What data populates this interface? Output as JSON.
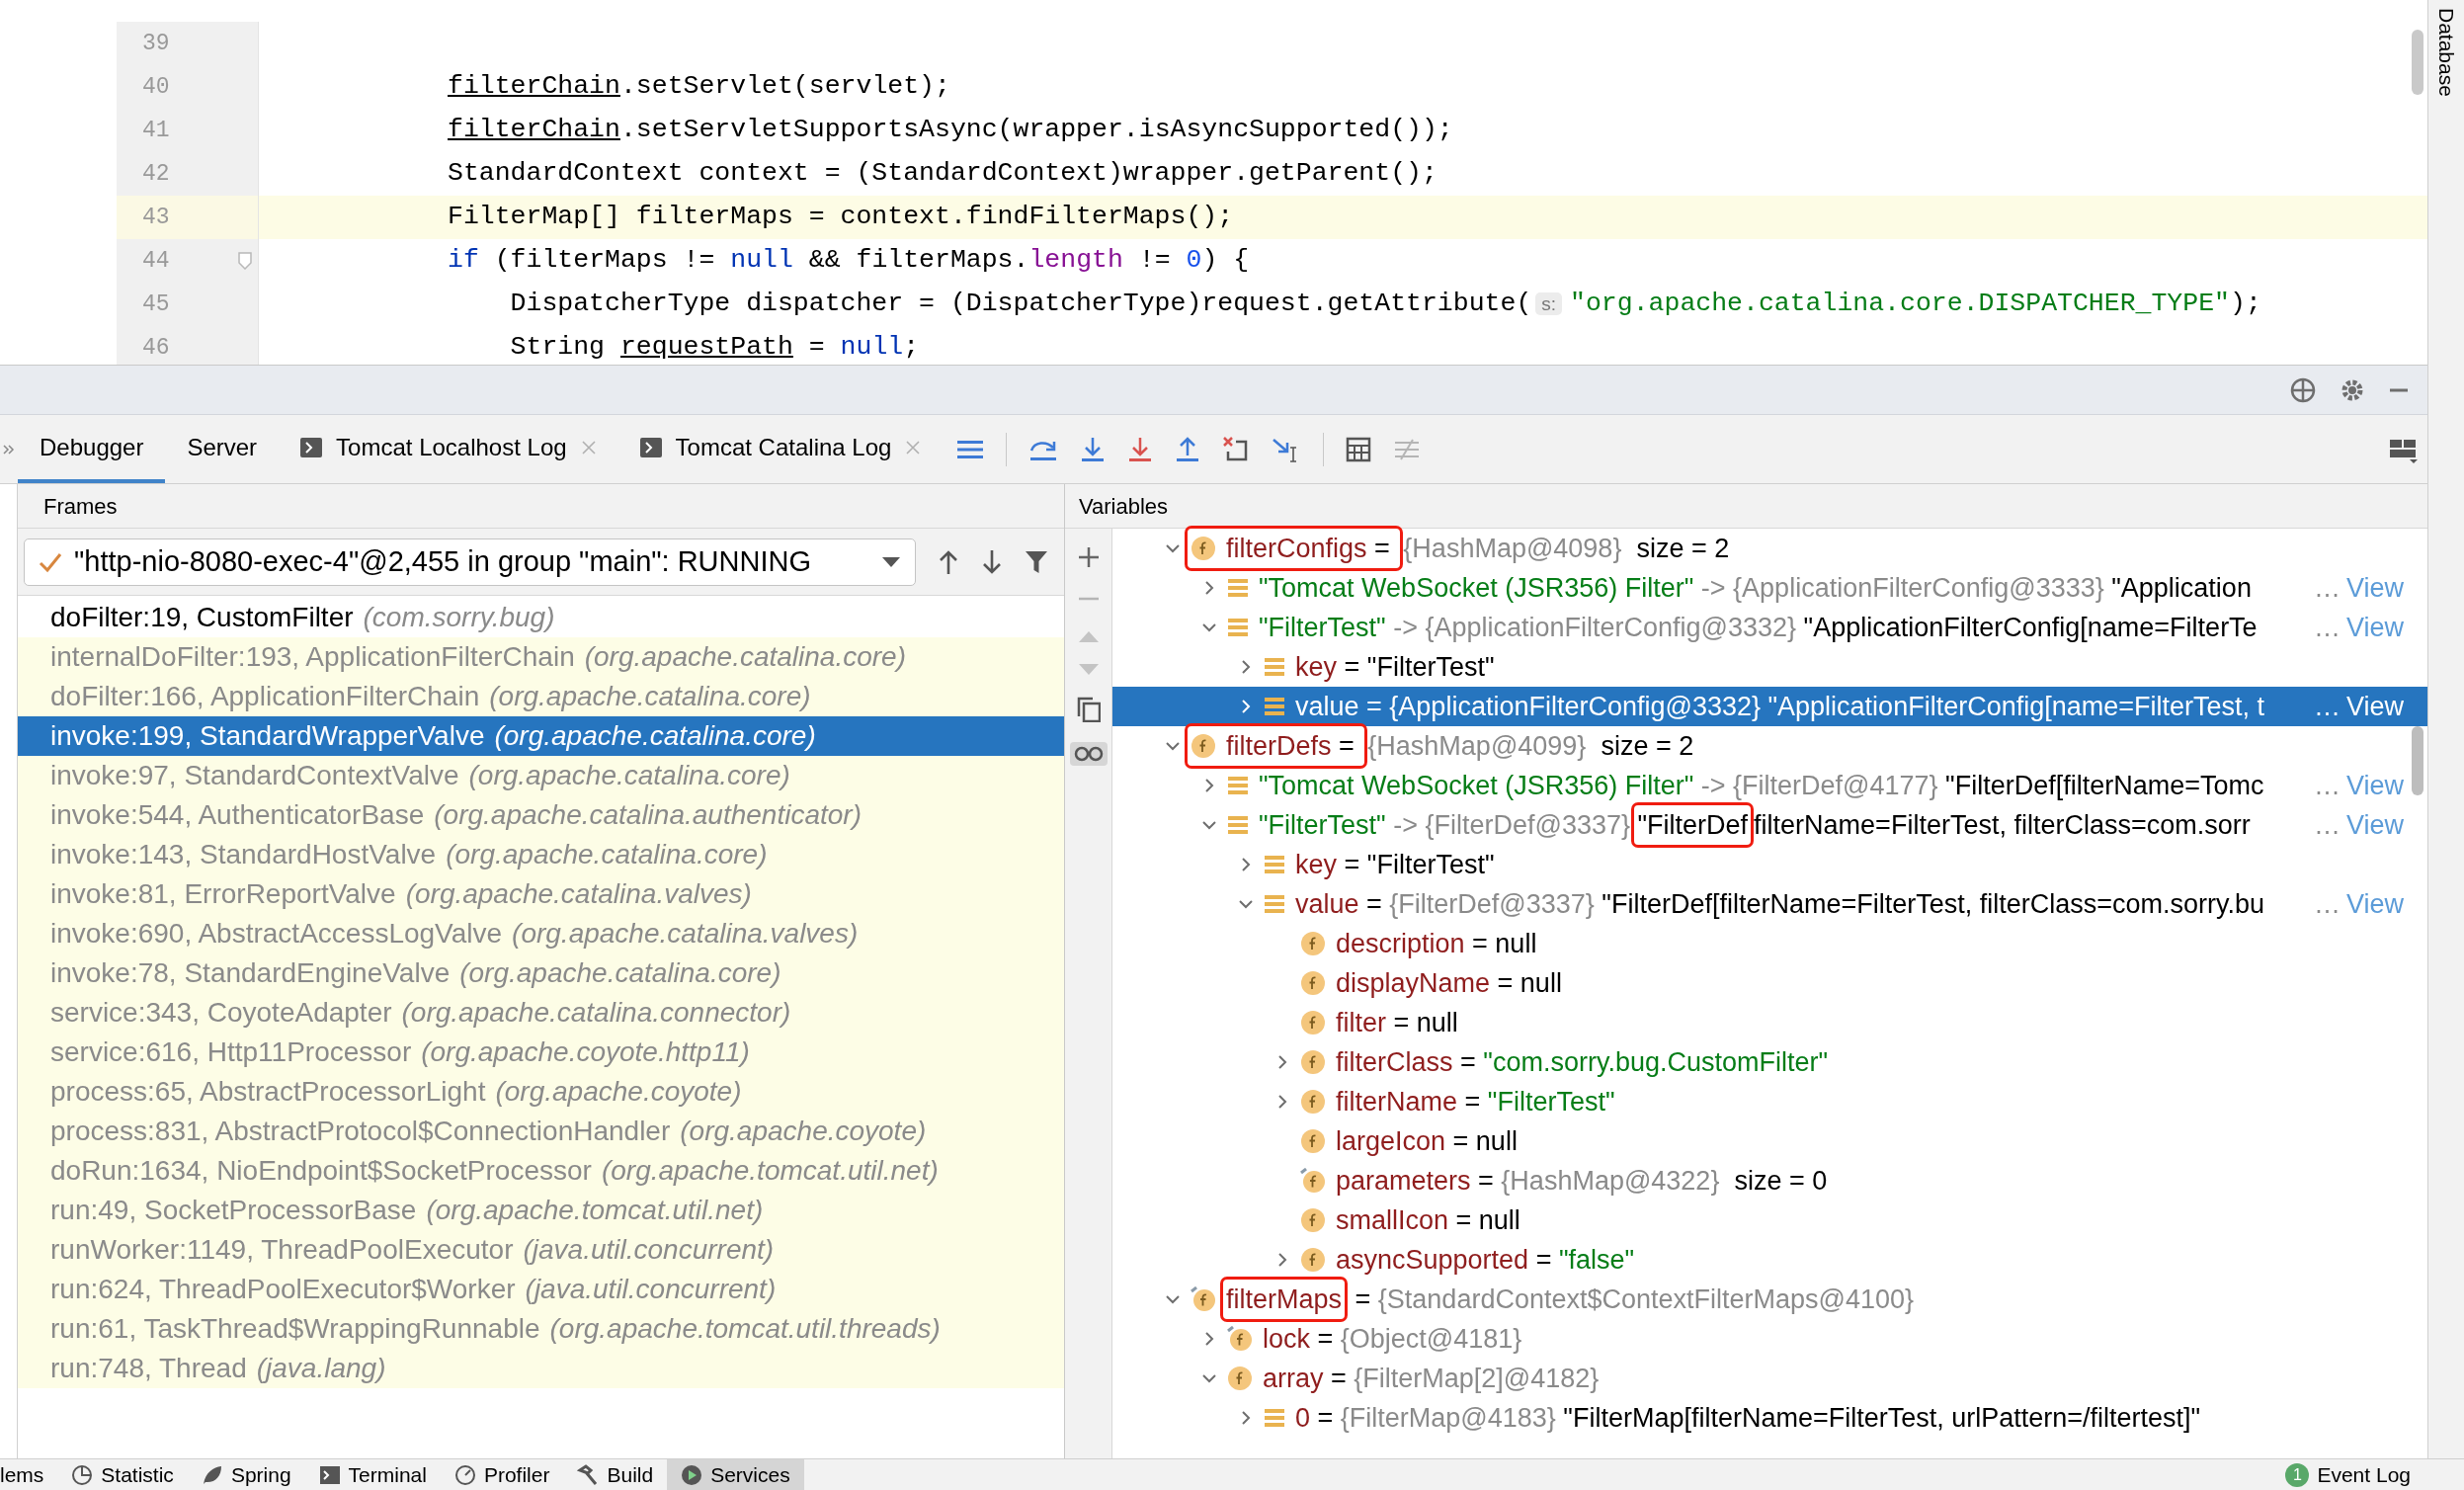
{
  "editor": {
    "lines": [
      {
        "number": "39",
        "fold": false,
        "current": false
      },
      {
        "number": "40",
        "fold": false,
        "current": false,
        "tokens": [
          {
            "text": "filterChain",
            "kind": "underline"
          },
          {
            "text": ".setServlet(servlet);",
            "kind": "plain"
          }
        ]
      },
      {
        "number": "41",
        "fold": false,
        "current": false,
        "tokens": [
          {
            "text": "filterChain",
            "kind": "underline"
          },
          {
            "text": ".setServletSupportsAsync(wrapper.isAsyncSupported());",
            "kind": "plain"
          }
        ]
      },
      {
        "number": "42",
        "fold": false,
        "current": false,
        "tokens": [
          {
            "text": "StandardContext context = (StandardContext)wrapper.getParent();",
            "kind": "plain"
          }
        ]
      },
      {
        "number": "43",
        "fold": false,
        "current": true,
        "tokens": [
          {
            "text": "FilterMap[] filterMaps = context.findFilterMaps();",
            "kind": "plain"
          }
        ]
      },
      {
        "number": "44",
        "fold": true,
        "current": false,
        "tokens": [
          {
            "text": "if",
            "kind": "keyword"
          },
          {
            "text": " (filterMaps != ",
            "kind": "plain"
          },
          {
            "text": "null",
            "kind": "keyword"
          },
          {
            "text": " && filterMaps.",
            "kind": "plain"
          },
          {
            "text": "length",
            "kind": "field"
          },
          {
            "text": " != ",
            "kind": "plain"
          },
          {
            "text": "0",
            "kind": "number"
          },
          {
            "text": ") {",
            "kind": "plain"
          }
        ]
      },
      {
        "number": "45",
        "fold": false,
        "current": false,
        "tokens": [
          {
            "text": "    DispatcherType dispatcher = (DispatcherType)request.getAttribute(",
            "kind": "plain"
          },
          {
            "text": "s:",
            "kind": "hint"
          },
          {
            "text": "\"org.apache.catalina.core.DISPATCHER_TYPE\"",
            "kind": "string"
          },
          {
            "text": ");",
            "kind": "plain"
          }
        ]
      },
      {
        "number": "46",
        "fold": false,
        "current": false,
        "tokens": [
          {
            "text": "    String ",
            "kind": "plain"
          },
          {
            "text": "requestPath",
            "kind": "underline"
          },
          {
            "text": " = ",
            "kind": "plain"
          },
          {
            "text": "null",
            "kind": "keyword"
          },
          {
            "text": ";",
            "kind": "plain"
          }
        ]
      }
    ]
  },
  "right_strip": {
    "label": "Database"
  },
  "debug": {
    "tabs": [
      {
        "label": "Debugger",
        "kind": "plain",
        "selected": true,
        "closable": false
      },
      {
        "label": "Server",
        "kind": "plain",
        "selected": false,
        "closable": false
      },
      {
        "label": "Tomcat Localhost Log",
        "kind": "log",
        "selected": false,
        "closable": true
      },
      {
        "label": "Tomcat Catalina Log",
        "kind": "log",
        "selected": false,
        "closable": true
      }
    ],
    "frames": {
      "title": "Frames",
      "thread": "\"http-nio-8080-exec-4\"@2,455 in group \"main\": RUNNING",
      "items": [
        {
          "method": "doFilter:19, CustomFilter",
          "package": "(com.sorry.bug)",
          "kind": "user",
          "selected": false
        },
        {
          "method": "internalDoFilter:193, ApplicationFilterChain",
          "package": "(org.apache.catalina.core)",
          "kind": "library",
          "selected": false
        },
        {
          "method": "doFilter:166, ApplicationFilterChain",
          "package": "(org.apache.catalina.core)",
          "kind": "library",
          "selected": false
        },
        {
          "method": "invoke:199, StandardWrapperValve",
          "package": "(org.apache.catalina.core)",
          "kind": "library",
          "selected": true
        },
        {
          "method": "invoke:97, StandardContextValve",
          "package": "(org.apache.catalina.core)",
          "kind": "library",
          "selected": false
        },
        {
          "method": "invoke:544, AuthenticatorBase",
          "package": "(org.apache.catalina.authenticator)",
          "kind": "library",
          "selected": false
        },
        {
          "method": "invoke:143, StandardHostValve",
          "package": "(org.apache.catalina.core)",
          "kind": "library",
          "selected": false
        },
        {
          "method": "invoke:81, ErrorReportValve",
          "package": "(org.apache.catalina.valves)",
          "kind": "library",
          "selected": false
        },
        {
          "method": "invoke:690, AbstractAccessLogValve",
          "package": "(org.apache.catalina.valves)",
          "kind": "library",
          "selected": false
        },
        {
          "method": "invoke:78, StandardEngineValve",
          "package": "(org.apache.catalina.core)",
          "kind": "library",
          "selected": false
        },
        {
          "method": "service:343, CoyoteAdapter",
          "package": "(org.apache.catalina.connector)",
          "kind": "library",
          "selected": false
        },
        {
          "method": "service:616, Http11Processor",
          "package": "(org.apache.coyote.http11)",
          "kind": "library",
          "selected": false
        },
        {
          "method": "process:65, AbstractProcessorLight",
          "package": "(org.apache.coyote)",
          "kind": "library",
          "selected": false
        },
        {
          "method": "process:831, AbstractProtocol$ConnectionHandler",
          "package": "(org.apache.coyote)",
          "kind": "library",
          "selected": false
        },
        {
          "method": "doRun:1634, NioEndpoint$SocketProcessor",
          "package": "(org.apache.tomcat.util.net)",
          "kind": "library",
          "selected": false
        },
        {
          "method": "run:49, SocketProcessorBase",
          "package": "(org.apache.tomcat.util.net)",
          "kind": "library",
          "selected": false
        },
        {
          "method": "runWorker:1149, ThreadPoolExecutor",
          "package": "(java.util.concurrent)",
          "kind": "library",
          "selected": false
        },
        {
          "method": "run:624, ThreadPoolExecutor$Worker",
          "package": "(java.util.concurrent)",
          "kind": "library",
          "selected": false
        },
        {
          "method": "run:61, TaskThread$WrappingRunnable",
          "package": "(org.apache.tomcat.util.threads)",
          "kind": "library",
          "selected": false
        },
        {
          "method": "run:748, Thread",
          "package": "(java.lang)",
          "kind": "library",
          "selected": false
        }
      ]
    },
    "variables": {
      "title": "Variables",
      "tree": [
        {
          "kind": "field",
          "expanded": true,
          "selected": false,
          "box_icon": true,
          "segments": [
            {
              "text": "filterConfigs",
              "kind": "name",
              "boxed": true
            },
            {
              "text": " = ",
              "kind": "plain",
              "boxed": true
            },
            {
              "text": "{HashMap@4098}",
              "kind": "type"
            },
            {
              "text": "  size = 2",
              "kind": "plain"
            }
          ],
          "children": [
            {
              "kind": "entry",
              "expanded": false,
              "selected": false,
              "segments": [
                {
                  "text": "\"Tomcat WebSocket (JSR356) Filter\"",
                  "kind": "string"
                },
                {
                  "text": " -> ",
                  "kind": "type"
                },
                {
                  "text": "{ApplicationFilterConfig@3333}",
                  "kind": "type"
                },
                {
                  "text": " \"Application",
                  "kind": "plain"
                }
              ],
              "ellipsis": "…",
              "view": "View"
            },
            {
              "kind": "entry",
              "expanded": true,
              "selected": false,
              "segments": [
                {
                  "text": "\"FilterTest\"",
                  "kind": "string"
                },
                {
                  "text": " -> ",
                  "kind": "type"
                },
                {
                  "text": "{ApplicationFilterConfig@3332}",
                  "kind": "type"
                },
                {
                  "text": " \"ApplicationFilterConfig[name=FilterTe",
                  "kind": "plain"
                }
              ],
              "ellipsis": "…",
              "view": "View",
              "children": [
                {
                  "kind": "entry",
                  "expanded": false,
                  "selected": false,
                  "segments": [
                    {
                      "text": "key",
                      "kind": "name"
                    },
                    {
                      "text": " = \"FilterTest\"",
                      "kind": "plain"
                    }
                  ]
                },
                {
                  "kind": "entry",
                  "expanded": false,
                  "selected": true,
                  "segments": [
                    {
                      "text": "value",
                      "kind": "name"
                    },
                    {
                      "text": " = ",
                      "kind": "plain"
                    },
                    {
                      "text": "{ApplicationFilterConfig@3332}",
                      "kind": "type"
                    },
                    {
                      "text": " \"ApplicationFilterConfig[name=FilterTest, t",
                      "kind": "plain"
                    }
                  ],
                  "ellipsis": "…",
                  "view": "View"
                }
              ]
            }
          ]
        },
        {
          "kind": "field",
          "expanded": true,
          "selected": false,
          "box_icon": true,
          "segments": [
            {
              "text": "filterDefs",
              "kind": "name",
              "boxed": true
            },
            {
              "text": " = ",
              "kind": "plain",
              "boxed": true
            },
            {
              "text": "{HashMap@4099}",
              "kind": "type"
            },
            {
              "text": "  size = 2",
              "kind": "plain"
            }
          ],
          "children": [
            {
              "kind": "entry",
              "expanded": false,
              "selected": false,
              "segments": [
                {
                  "text": "\"Tomcat WebSocket (JSR356) Filter\"",
                  "kind": "string"
                },
                {
                  "text": " -> ",
                  "kind": "type"
                },
                {
                  "text": "{FilterDef@4177}",
                  "kind": "type"
                },
                {
                  "text": " \"FilterDef[filterName=Tomc",
                  "kind": "plain"
                }
              ],
              "ellipsis": "…",
              "view": "View"
            },
            {
              "kind": "entry",
              "expanded": true,
              "selected": false,
              "segments": [
                {
                  "text": "\"FilterTest\"",
                  "kind": "string"
                },
                {
                  "text": " -> ",
                  "kind": "type"
                },
                {
                  "text": "{FilterDef@3337} ",
                  "kind": "type"
                },
                {
                  "text": "\"FilterDef",
                  "kind": "plain",
                  "boxed": true
                },
                {
                  "text": "filterName=FilterTest, filterClass=com.sorr",
                  "kind": "plain"
                }
              ],
              "ellipsis": "…",
              "view": "View",
              "children": [
                {
                  "kind": "entry",
                  "expanded": false,
                  "selected": false,
                  "segments": [
                    {
                      "text": "key",
                      "kind": "name"
                    },
                    {
                      "text": " = \"FilterTest\"",
                      "kind": "plain"
                    }
                  ]
                },
                {
                  "kind": "entry",
                  "expanded": true,
                  "selected": false,
                  "segments": [
                    {
                      "text": "value",
                      "kind": "name"
                    },
                    {
                      "text": " = ",
                      "kind": "plain"
                    },
                    {
                      "text": "{FilterDef@3337}",
                      "kind": "type"
                    },
                    {
                      "text": " \"FilterDef[filterName=FilterTest, filterClass=com.sorry.bu",
                      "kind": "plain"
                    }
                  ],
                  "ellipsis": "…",
                  "view": "View",
                  "children": [
                    {
                      "kind": "field",
                      "selected": false,
                      "segments": [
                        {
                          "text": "description",
                          "kind": "name"
                        },
                        {
                          "text": " = null",
                          "kind": "plain"
                        }
                      ]
                    },
                    {
                      "kind": "field",
                      "selected": false,
                      "segments": [
                        {
                          "text": "displayName",
                          "kind": "name"
                        },
                        {
                          "text": " = null",
                          "kind": "plain"
                        }
                      ]
                    },
                    {
                      "kind": "field",
                      "selected": false,
                      "segments": [
                        {
                          "text": "filter",
                          "kind": "name"
                        },
                        {
                          "text": " = null",
                          "kind": "plain"
                        }
                      ]
                    },
                    {
                      "kind": "field",
                      "expanded": false,
                      "selected": false,
                      "segments": [
                        {
                          "text": "filterClass",
                          "kind": "name"
                        },
                        {
                          "text": " = ",
                          "kind": "plain"
                        },
                        {
                          "text": "\"com.sorry.bug.CustomFilter\"",
                          "kind": "string"
                        }
                      ]
                    },
                    {
                      "kind": "field",
                      "expanded": false,
                      "selected": false,
                      "segments": [
                        {
                          "text": "filterName",
                          "kind": "name"
                        },
                        {
                          "text": " = ",
                          "kind": "plain"
                        },
                        {
                          "text": "\"FilterTest\"",
                          "kind": "string"
                        }
                      ]
                    },
                    {
                      "kind": "field",
                      "selected": false,
                      "segments": [
                        {
                          "text": "largeIcon",
                          "kind": "name"
                        },
                        {
                          "text": " = null",
                          "kind": "plain"
                        }
                      ]
                    },
                    {
                      "kind": "pinned",
                      "selected": false,
                      "segments": [
                        {
                          "text": "parameters",
                          "kind": "name"
                        },
                        {
                          "text": " = ",
                          "kind": "plain"
                        },
                        {
                          "text": "{HashMap@4322}",
                          "kind": "type"
                        },
                        {
                          "text": "  size = 0",
                          "kind": "plain"
                        }
                      ]
                    },
                    {
                      "kind": "field",
                      "selected": false,
                      "segments": [
                        {
                          "text": "smallIcon",
                          "kind": "name"
                        },
                        {
                          "text": " = null",
                          "kind": "plain"
                        }
                      ]
                    },
                    {
                      "kind": "field",
                      "expanded": false,
                      "selected": false,
                      "segments": [
                        {
                          "text": "asyncSupported",
                          "kind": "name"
                        },
                        {
                          "text": " = ",
                          "kind": "plain"
                        },
                        {
                          "text": "\"false\"",
                          "kind": "string"
                        }
                      ]
                    }
                  ]
                }
              ]
            }
          ]
        },
        {
          "kind": "pinned",
          "expanded": true,
          "selected": false,
          "box_icon": false,
          "segments": [
            {
              "text": "filterMaps",
              "kind": "name",
              "boxed": true
            },
            {
              "text": " = ",
              "kind": "plain"
            },
            {
              "text": "{StandardContext$ContextFilterMaps@4100}",
              "kind": "type"
            }
          ],
          "children": [
            {
              "kind": "pinned",
              "expanded": false,
              "selected": false,
              "segments": [
                {
                  "text": "lock",
                  "kind": "name"
                },
                {
                  "text": " = ",
                  "kind": "plain"
                },
                {
                  "text": "{Object@4181}",
                  "kind": "type"
                }
              ]
            },
            {
              "kind": "field",
              "expanded": true,
              "selected": false,
              "segments": [
                {
                  "text": "array",
                  "kind": "name"
                },
                {
                  "text": " = ",
                  "kind": "plain"
                },
                {
                  "text": "{FilterMap[2]@4182}",
                  "kind": "type"
                }
              ],
              "children": [
                {
                  "kind": "entry",
                  "expanded": false,
                  "selected": false,
                  "segments": [
                    {
                      "text": "0",
                      "kind": "name"
                    },
                    {
                      "text": " = ",
                      "kind": "plain"
                    },
                    {
                      "text": "{FilterMap@4183}",
                      "kind": "type"
                    },
                    {
                      "text": " \"FilterMap[filterName=FilterTest, urlPattern=/filtertest]\"",
                      "kind": "plain"
                    }
                  ]
                }
              ]
            }
          ]
        }
      ]
    }
  },
  "bottom_bar": {
    "items": [
      {
        "label": "lems",
        "kind": "plain",
        "selected": false
      },
      {
        "label": "Statistic",
        "kind": "statistic",
        "selected": false
      },
      {
        "label": "Spring",
        "kind": "spring",
        "selected": false
      },
      {
        "label": "Terminal",
        "kind": "terminal",
        "selected": false
      },
      {
        "label": "Profiler",
        "kind": "profiler",
        "selected": false
      },
      {
        "label": "Build",
        "kind": "build",
        "selected": false
      },
      {
        "label": "Services",
        "kind": "services",
        "selected": true
      }
    ],
    "event_log": {
      "count": "1",
      "label": "Event Log"
    }
  }
}
